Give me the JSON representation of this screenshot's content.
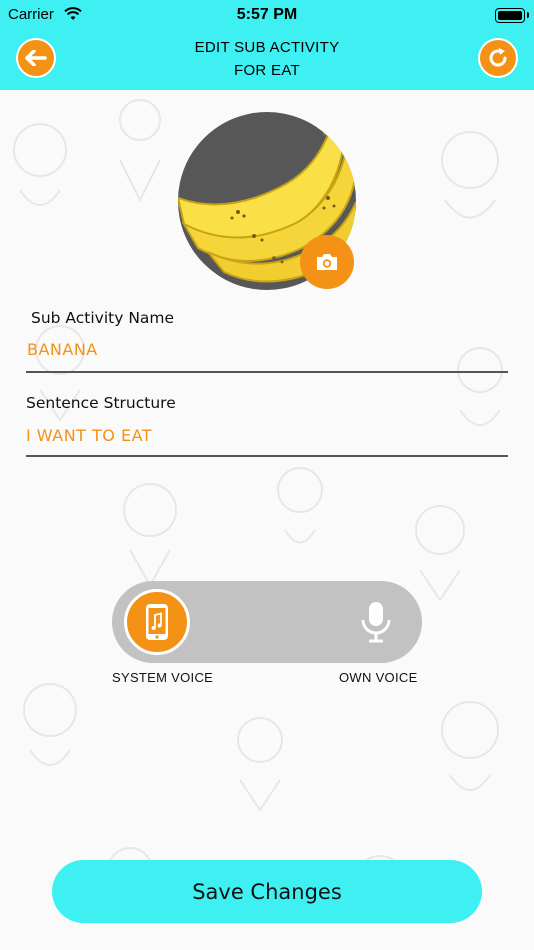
{
  "status_bar": {
    "carrier": "Carrier",
    "time": "5:57 PM"
  },
  "header": {
    "title_line1": "EDIT SUB ACTIVITY",
    "title_line2": "FOR EAT",
    "back_icon": "arrow-left-icon",
    "refresh_icon": "refresh-icon"
  },
  "image": {
    "subject": "banana-image",
    "camera_icon": "camera-icon"
  },
  "fields": {
    "name": {
      "label": "Sub Activity Name",
      "value": "BANANA"
    },
    "sentence": {
      "label": "Sentence Structure",
      "value": "I WANT TO EAT"
    }
  },
  "voice_toggle": {
    "system_label": "SYSTEM VOICE",
    "own_label": "OWN VOICE",
    "selected": "SYSTEM VOICE"
  },
  "save_label": "Save Changes",
  "colors": {
    "accent": "#f39214",
    "header": "#3ef0f2",
    "track": "#c2c2c2"
  }
}
